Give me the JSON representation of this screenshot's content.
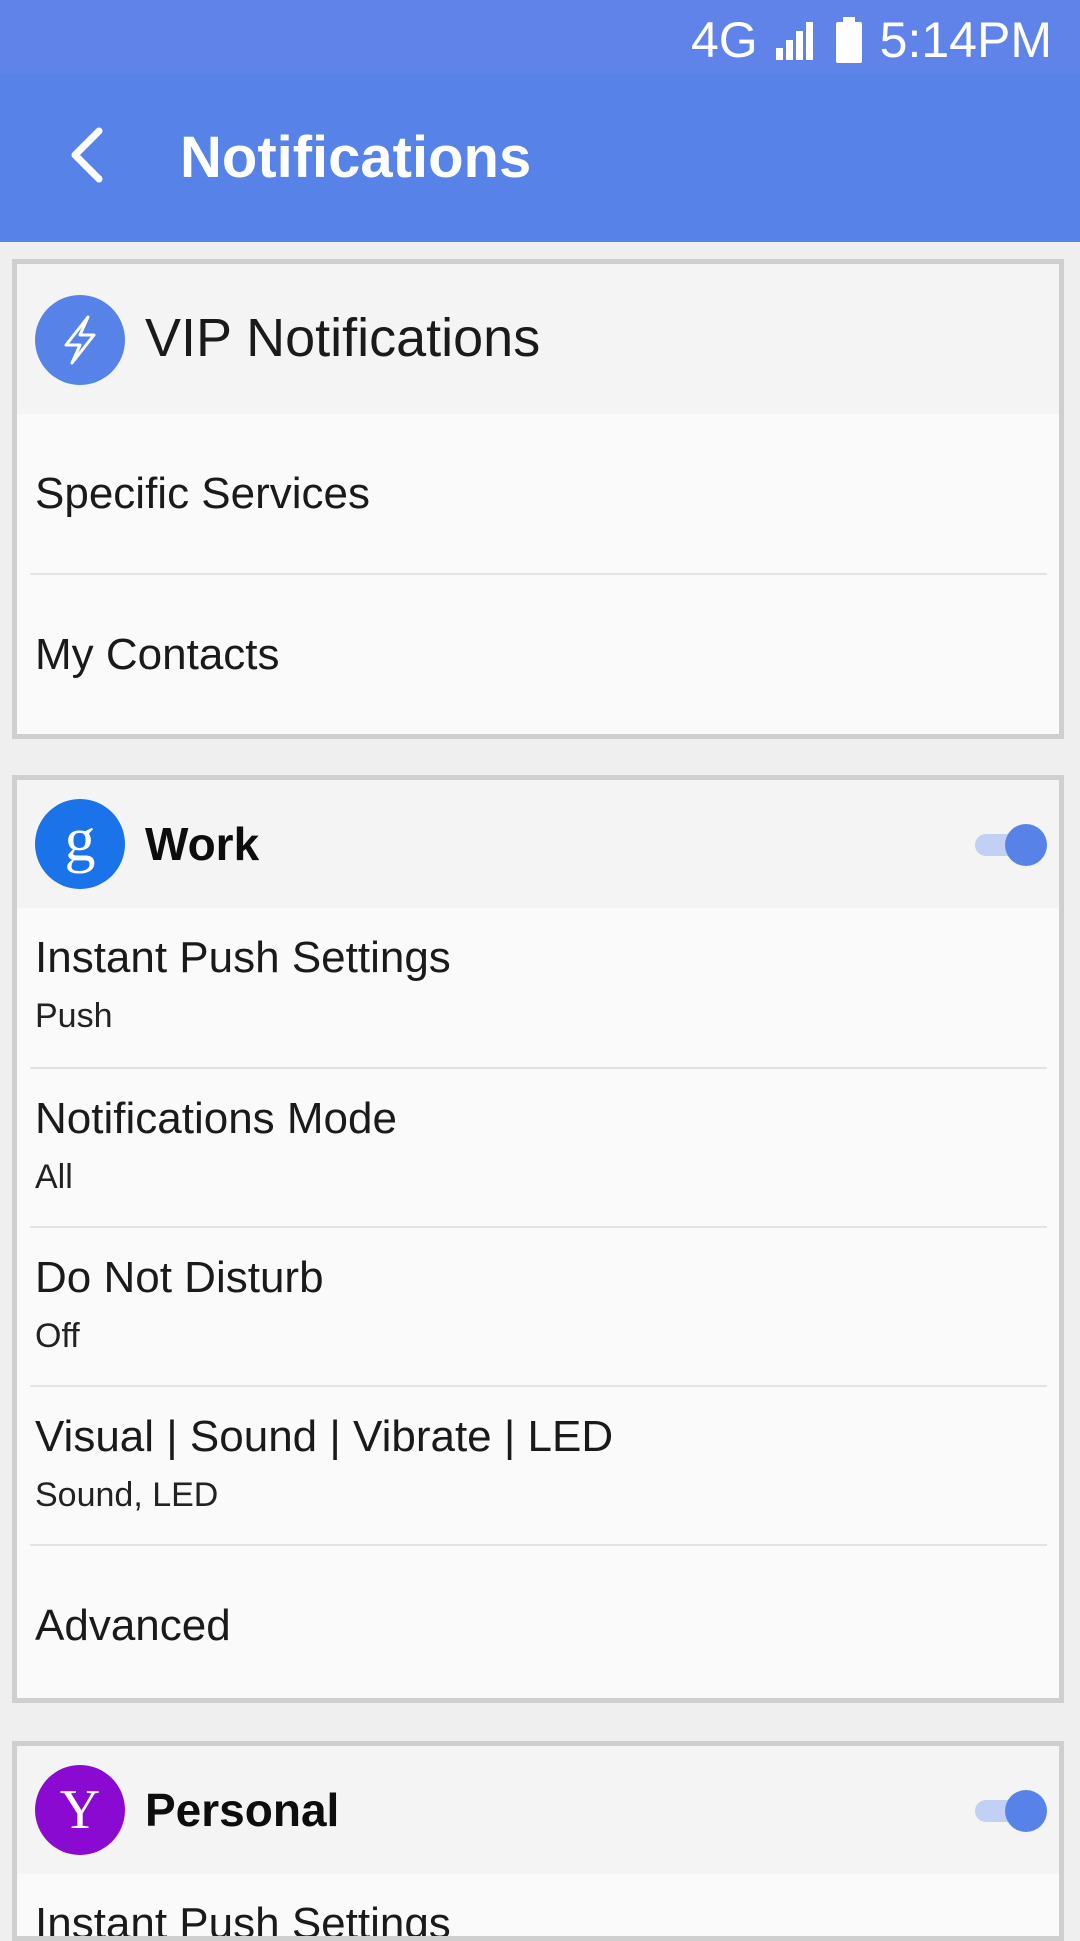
{
  "status_bar": {
    "network": "4G",
    "time": "5:14PM",
    "signal_icon": "signal-icon",
    "battery_icon": "battery-icon"
  },
  "app_bar": {
    "title": "Notifications",
    "back_icon": "chevron-left-icon"
  },
  "vip": {
    "title": "VIP Notifications",
    "icon": "lightning-icon",
    "icon_color": "#5783e8",
    "items": [
      {
        "label": "Specific Services"
      },
      {
        "label": "My Contacts"
      }
    ]
  },
  "accounts": [
    {
      "name": "Work",
      "icon_letter": "g",
      "icon_color": "#1a73e8",
      "enabled": true,
      "settings": [
        {
          "label": "Instant Push Settings",
          "value": "Push"
        },
        {
          "label": "Notifications Mode",
          "value": "All"
        },
        {
          "label": "Do Not Disturb",
          "value": "Off"
        },
        {
          "label": "Visual | Sound | Vibrate | LED",
          "value": "Sound, LED"
        }
      ],
      "advanced_label": "Advanced"
    },
    {
      "name": "Personal",
      "icon_letter": "Y",
      "icon_color": "#8a0ad1",
      "enabled": true,
      "settings": [
        {
          "label": "Instant Push Settings"
        }
      ]
    }
  ],
  "colors": {
    "accent": "#5783e8",
    "status_bar": "#6083ea",
    "toggle_track": "#c2d0f5"
  }
}
